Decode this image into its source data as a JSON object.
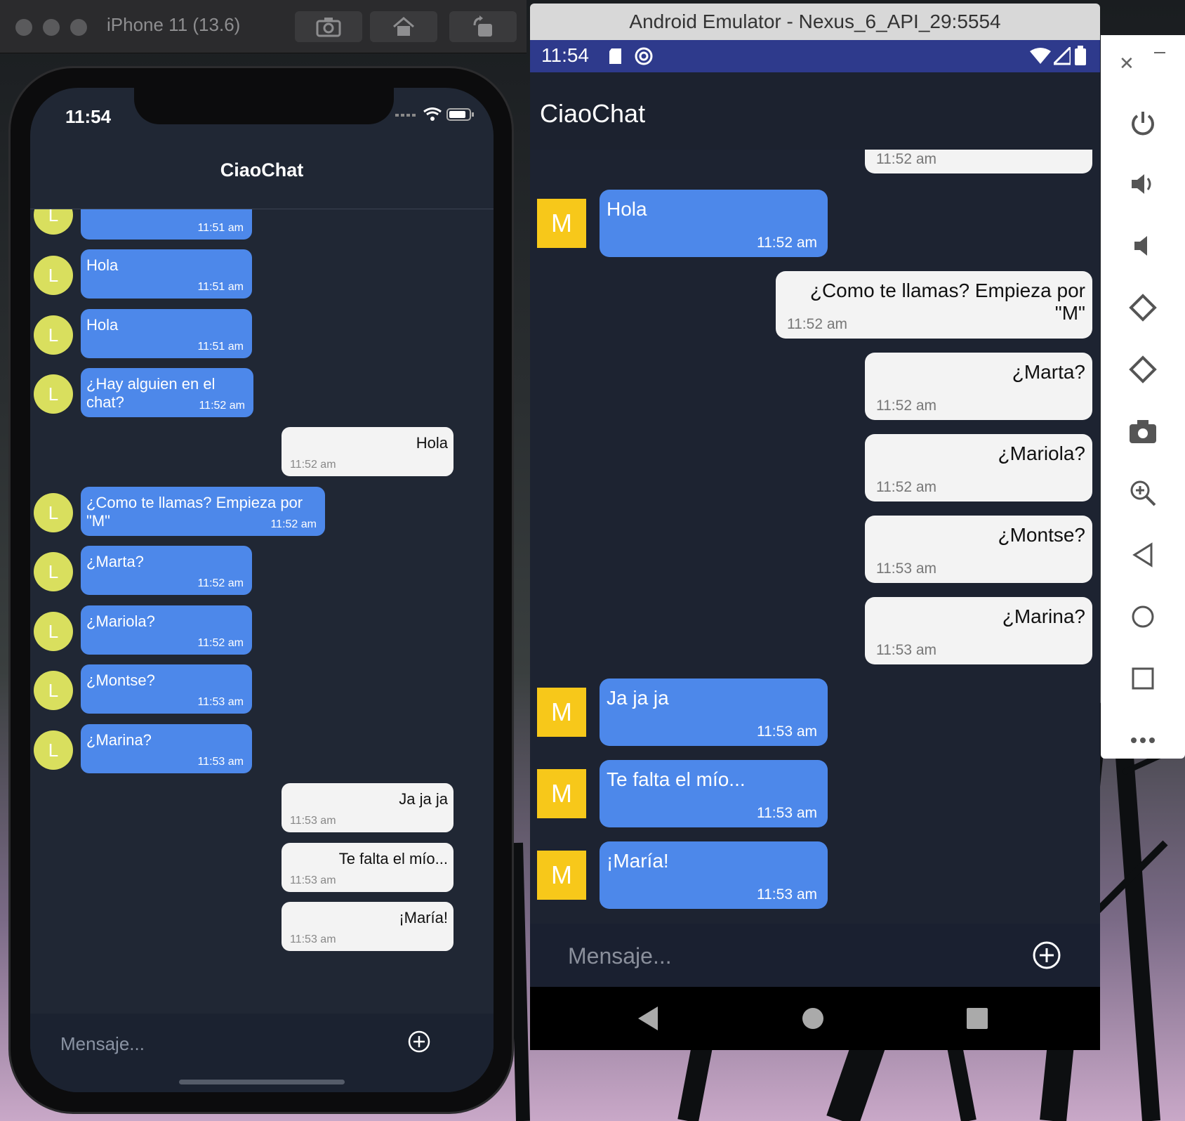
{
  "colors": {
    "ios_bubble_in": "#4d88ea",
    "bubble_out": "#f3f3f3",
    "avatar_l": "#d9df5e",
    "avatar_m": "#f7c81a",
    "android_status": "#2e3a8c"
  },
  "ios": {
    "window_title": "iPhone 11 (13.6)",
    "toolbar_icons": [
      "screenshot-icon",
      "home-icon",
      "rotate-icon"
    ],
    "status_time": "11:54",
    "nav_title": "CiaoChat",
    "input_placeholder": "Mensaje...",
    "messages": [
      {
        "side": "in",
        "avatar": "L",
        "text": "",
        "time": "11:51 am"
      },
      {
        "side": "in",
        "avatar": "L",
        "text": "Hola",
        "time": "11:51 am"
      },
      {
        "side": "in",
        "avatar": "L",
        "text": "Hola",
        "time": "11:51 am"
      },
      {
        "side": "in",
        "avatar": "L",
        "text": "¿Hay alguien en el chat?",
        "time": "11:52 am"
      },
      {
        "side": "out",
        "avatar": "",
        "text": "Hola",
        "time": "11:52 am"
      },
      {
        "side": "in",
        "avatar": "L",
        "text": "¿Como te llamas? Empieza por \"M\"",
        "time": "11:52 am"
      },
      {
        "side": "in",
        "avatar": "L",
        "text": "¿Marta?",
        "time": "11:52 am"
      },
      {
        "side": "in",
        "avatar": "L",
        "text": "¿Mariola?",
        "time": "11:52 am"
      },
      {
        "side": "in",
        "avatar": "L",
        "text": "¿Montse?",
        "time": "11:53 am"
      },
      {
        "side": "in",
        "avatar": "L",
        "text": "¿Marina?",
        "time": "11:53 am"
      },
      {
        "side": "out",
        "avatar": "",
        "text": "Ja ja ja",
        "time": "11:53 am"
      },
      {
        "side": "out",
        "avatar": "",
        "text": "Te falta el mío...",
        "time": "11:53 am"
      },
      {
        "side": "out",
        "avatar": "",
        "text": "¡María!",
        "time": "11:53 am"
      }
    ]
  },
  "android": {
    "window_title": "Android Emulator - Nexus_6_API_29:5554",
    "status_time": "11:54",
    "app_title": "CiaoChat",
    "input_placeholder": "Mensaje...",
    "messages": [
      {
        "side": "out",
        "avatar": "",
        "text": "",
        "time": "11:52 am"
      },
      {
        "side": "in",
        "avatar": "M",
        "text": "Hola",
        "time": "11:52 am"
      },
      {
        "side": "out",
        "avatar": "",
        "text": "¿Como te llamas? Empieza por \"M\"",
        "time": "11:52 am"
      },
      {
        "side": "out",
        "avatar": "",
        "text": "¿Marta?",
        "time": "11:52 am"
      },
      {
        "side": "out",
        "avatar": "",
        "text": "¿Mariola?",
        "time": "11:52 am"
      },
      {
        "side": "out",
        "avatar": "",
        "text": "¿Montse?",
        "time": "11:53 am"
      },
      {
        "side": "out",
        "avatar": "",
        "text": "¿Marina?",
        "time": "11:53 am"
      },
      {
        "side": "in",
        "avatar": "M",
        "text": "Ja ja ja",
        "time": "11:53 am"
      },
      {
        "side": "in",
        "avatar": "M",
        "text": "Te falta el mío...",
        "time": "11:53 am"
      },
      {
        "side": "in",
        "avatar": "M",
        "text": "¡María!",
        "time": "11:53 am"
      }
    ],
    "side_controls": [
      "power-icon",
      "volume-up-icon",
      "volume-down-icon",
      "rotate-left-icon",
      "rotate-right-icon",
      "camera-icon",
      "zoom-icon",
      "back-icon",
      "home-icon",
      "overview-icon",
      "more-icon"
    ]
  }
}
